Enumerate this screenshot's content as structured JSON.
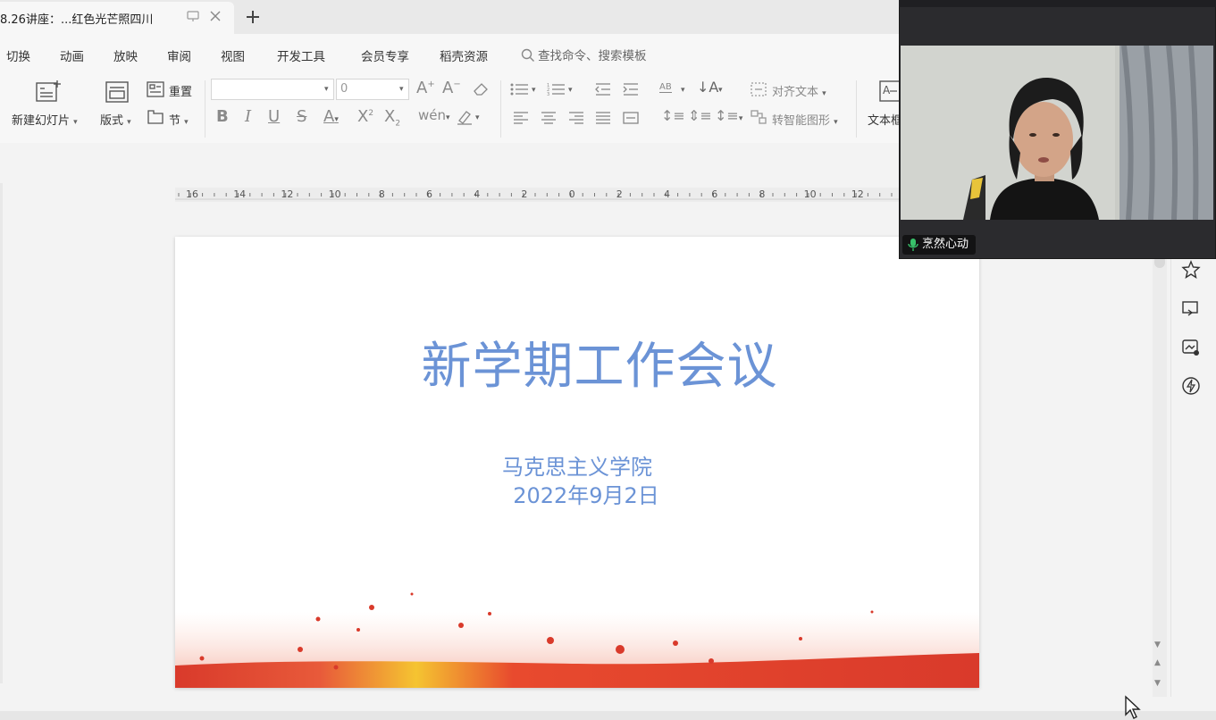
{
  "tab": {
    "title": "8.26讲座：...红色光芒照四川",
    "add_label": "+"
  },
  "menu": {
    "items": [
      "切换",
      "动画",
      "放映",
      "审阅",
      "视图",
      "开发工具",
      "会员专享",
      "稻壳资源"
    ],
    "search_placeholder": "查找命令、搜索模板"
  },
  "ribbon": {
    "new_slide": "新建幻灯片",
    "layout": "版式",
    "reset": "重置",
    "section": "节",
    "font_name": "",
    "font_size": "0",
    "align_text": "对齐文本",
    "smart_art": "转智能图形",
    "textbox": "文本框"
  },
  "ruler": {
    "labels": [
      "16",
      "14",
      "12",
      "10",
      "8",
      "6",
      "4",
      "2",
      "0",
      "2",
      "4",
      "6",
      "8",
      "10",
      "12"
    ]
  },
  "slide": {
    "title": "新学期工作会议",
    "subtitle": "马克思主义学院",
    "date": "2022年9月2日"
  },
  "video": {
    "participant": "烹然心动"
  },
  "colors": {
    "title_blue": "#6b93d6",
    "mic_green": "#38c16a",
    "decor_red": "#d93a2b",
    "decor_yellow": "#f5c431"
  }
}
